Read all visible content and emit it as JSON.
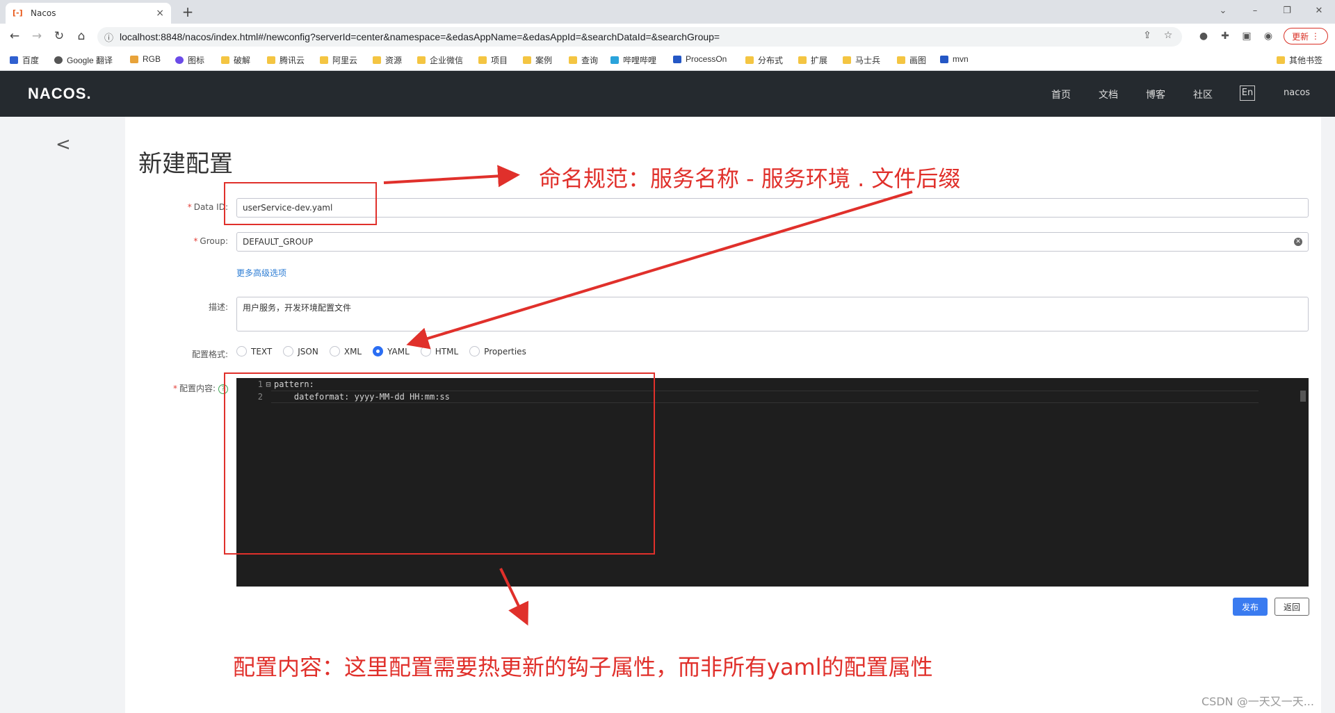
{
  "browser": {
    "tab_title": "Nacos",
    "tab_close": "×",
    "new_tab": "+",
    "url": "localhost:8848/nacos/index.html#/newconfig?serverId=center&namespace=&edasAppName=&edasAppId=&searchDataId=&searchGroup=",
    "update_label": "更新",
    "bookmarks": [
      "百度",
      "Google 翻译",
      "RGB",
      "图标",
      "破解",
      "腾讯云",
      "阿里云",
      "资源",
      "企业微信",
      "项目",
      "案例",
      "查询",
      "哔哩哔哩",
      "ProcessOn",
      "分布式",
      "扩展",
      "马士兵",
      "画图",
      "mvn"
    ],
    "other_bookmarks": "其他书签"
  },
  "header": {
    "logo": "NACOS.",
    "nav": [
      "首页",
      "文档",
      "博客",
      "社区"
    ],
    "lang": "En",
    "user": "nacos"
  },
  "form": {
    "page_title": "新建配置",
    "data_id_label": "Data ID:",
    "data_id_value": "userService-dev.yaml",
    "group_label": "Group:",
    "group_value": "DEFAULT_GROUP",
    "advanced_link": "更多高级选项",
    "desc_label": "描述:",
    "desc_value": "用户服务，开发环境配置文件",
    "format_label": "配置格式:",
    "formats": [
      "TEXT",
      "JSON",
      "XML",
      "YAML",
      "HTML",
      "Properties"
    ],
    "selected_format": "YAML",
    "content_label": "配置内容:",
    "editor_lines": [
      {
        "num": "1",
        "text": "pattern:"
      },
      {
        "num": "2",
        "text": "    dateformat: yyyy-MM-dd HH:mm:ss"
      }
    ],
    "publish_label": "发布",
    "back_label": "返回"
  },
  "annotations": {
    "naming_rule": "命名规范：服务名称 - 服务环境 . 文件后缀",
    "content_note": "配置内容：这里配置需要热更新的钩子属性，而非所有yaml的配置属性",
    "color": "#e0302b"
  },
  "watermark": "CSDN @一天又一天..."
}
